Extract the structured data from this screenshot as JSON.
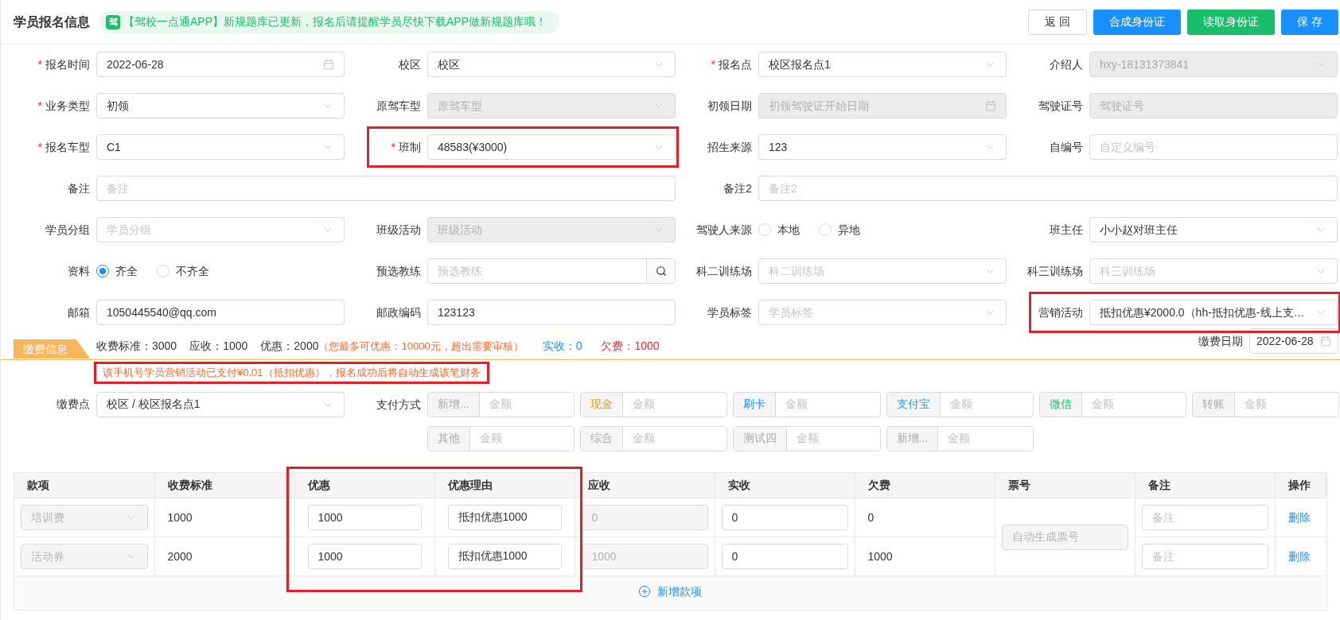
{
  "header": {
    "title": "学员报名信息",
    "notice": {
      "badge": "驾",
      "text": "【驾校一点通APP】新规题库已更新，报名后请提醒学员尽快下载APP做新规题库哦！"
    },
    "buttons": [
      {
        "label": "返 回",
        "kind": "default"
      },
      {
        "label": "合成身份证",
        "kind": "primary"
      },
      {
        "label": "读取身份证",
        "kind": "success"
      },
      {
        "label": "保 存",
        "kind": "primary"
      }
    ]
  },
  "form": {
    "fields": [
      {
        "required_mark": "*",
        "label": "报名时间",
        "kind": "date",
        "value": "2022-06-28",
        "disabled": false,
        "highlighted": false
      },
      {
        "label": "校区",
        "kind": "select",
        "value": "校区",
        "disabled": false,
        "highlighted": false
      },
      {
        "required_mark": "*",
        "label": "报名点",
        "kind": "select",
        "value": "校区报名点1",
        "disabled": false,
        "highlighted": false
      },
      {
        "label": "介绍人",
        "kind": "select",
        "value": "hxy-18131373841",
        "disabled": true,
        "highlighted": false
      },
      {
        "required_mark": "*",
        "label": "业务类型",
        "kind": "select",
        "value": "初领",
        "disabled": false,
        "highlighted": false
      },
      {
        "label": "原驾车型",
        "kind": "select",
        "placeholder": "原驾车型",
        "disabled": true,
        "highlighted": false
      },
      {
        "label": "初领日期",
        "kind": "date",
        "placeholder": "初领驾驶证开始日期",
        "disabled": true,
        "highlighted": false
      },
      {
        "label": "驾驶证号",
        "kind": "text",
        "placeholder": "驾驶证号",
        "disabled": true,
        "highlighted": false
      },
      {
        "required_mark": "*",
        "label": "报名车型",
        "kind": "select",
        "value": "C1",
        "disabled": false,
        "highlighted": false
      },
      {
        "required_mark": "*",
        "label": "班制",
        "kind": "select",
        "value": "48583(¥3000)",
        "disabled": false,
        "highlighted": true
      },
      {
        "label": "招生来源",
        "kind": "select",
        "value": "123",
        "disabled": false,
        "highlighted": false
      },
      {
        "label": "自编号",
        "kind": "text",
        "placeholder": "自定义编号",
        "disabled": false,
        "highlighted": false
      },
      {
        "label": "备注",
        "kind": "text",
        "placeholder": "备注",
        "wide": true,
        "disabled": false,
        "highlighted": false
      },
      {
        "label": "备注2",
        "kind": "text",
        "placeholder": "备注2",
        "wide": true,
        "disabled": false,
        "highlighted": false
      },
      {
        "label": "学员分组",
        "kind": "select",
        "placeholder": "学员分组",
        "disabled": false,
        "highlighted": false
      },
      {
        "label": "班级活动",
        "kind": "select",
        "placeholder": "班级活动",
        "disabled": true,
        "highlighted": false
      },
      {
        "label": "驾驶人来源",
        "kind": "radio",
        "options": [
          {
            "label": "本地",
            "selected": false
          },
          {
            "label": "异地",
            "selected": false
          }
        ],
        "highlighted": false
      },
      {
        "label": "班主任",
        "kind": "select",
        "value": "小小赵对班主任",
        "disabled": false,
        "highlighted": false
      },
      {
        "label": "资料",
        "kind": "radio",
        "options": [
          {
            "label": "齐全",
            "selected": true
          },
          {
            "label": "不齐全",
            "selected": false
          }
        ],
        "highlighted": false
      },
      {
        "label": "预选教练",
        "kind": "search",
        "placeholder": "预选教练",
        "disabled": false,
        "highlighted": false
      },
      {
        "label": "科二训练场",
        "kind": "select",
        "placeholder": "科二训练场",
        "disabled": false,
        "highlighted": false
      },
      {
        "label": "科三训练场",
        "kind": "select",
        "placeholder": "科三训练场",
        "disabled": false,
        "highlighted": false
      },
      {
        "label": "邮箱",
        "kind": "text",
        "value": "1050445540@qq.com",
        "disabled": false,
        "highlighted": false
      },
      {
        "label": "邮政编码",
        "kind": "text",
        "value": "123123",
        "disabled": false,
        "highlighted": false
      },
      {
        "label": "学员标签",
        "kind": "select",
        "placeholder": "学员标签",
        "disabled": false,
        "highlighted": false
      },
      {
        "label": "营销活动",
        "kind": "select",
        "value": "抵扣优惠¥2000.0（hh-抵扣优惠-线上支…",
        "disabled": false,
        "highlighted": true
      }
    ]
  },
  "fee": {
    "tab": "缴费信息",
    "summary": [
      {
        "label": "收费标准：",
        "value": "3000",
        "color": "#333333"
      },
      {
        "label": "应收：",
        "value": "1000",
        "color": "#333333"
      },
      {
        "label": "优惠：",
        "value": "2000",
        "color": "#333333"
      }
    ],
    "limit_note": "（您最多可优惠：10000元，超出需要审核）",
    "totals": [
      {
        "label": "实收：",
        "value": "0",
        "color": "#1890ff"
      },
      {
        "label": "欠费：",
        "value": "1000",
        "color": "#f5222d"
      }
    ],
    "date": {
      "label": "缴费日期",
      "value": "2022-06-28"
    },
    "notice": {
      "text": "该手机号学员营销活动已支付¥0.01（抵扣优惠），报名成功后将自动生成该笔财务",
      "highlighted": true
    }
  },
  "payment": {
    "point": {
      "label": "缴费点",
      "value": "校区 / 校区报名点1"
    },
    "methods_label": "支付方式",
    "methods": [
      {
        "label": "新增...",
        "color": "#aaaaaa",
        "placeholder": "金额"
      },
      {
        "label": "现金",
        "color": "#d4a017",
        "placeholder": "金额"
      },
      {
        "label": "刷卡",
        "color": "#1890ff",
        "placeholder": "金额"
      },
      {
        "label": "支付宝",
        "color": "#1ca3e6",
        "placeholder": "金额"
      },
      {
        "label": "微信",
        "color": "#19be6b",
        "placeholder": "金额"
      },
      {
        "label": "转账",
        "color": "#aaaaaa",
        "placeholder": "金额"
      },
      {
        "label": "其他",
        "color": "#aaaaaa",
        "placeholder": "金额"
      },
      {
        "label": "综合",
        "color": "#aaaaaa",
        "placeholder": "金额"
      },
      {
        "label": "测试四",
        "color": "#aaaaaa",
        "placeholder": "金额"
      },
      {
        "label": "新增...",
        "color": "#aaaaaa",
        "placeholder": "金额"
      }
    ]
  },
  "table": {
    "columns": [
      {
        "label": "款项",
        "highlighted": false
      },
      {
        "label": "收费标准",
        "highlighted": false
      },
      {
        "label": "优惠",
        "highlighted": true
      },
      {
        "label": "优惠理由",
        "highlighted": true
      },
      {
        "label": "应收",
        "highlighted": false
      },
      {
        "label": "实收",
        "highlighted": false
      },
      {
        "label": "欠费",
        "highlighted": false
      },
      {
        "label": "票号",
        "highlighted": false
      },
      {
        "label": "备注",
        "highlighted": false
      },
      {
        "label": "操作",
        "highlighted": false
      }
    ],
    "rows": [
      {
        "item": "培训费",
        "standard": "1000",
        "discount": "1000",
        "reason": "抵扣优惠1000",
        "receivable": "0",
        "received": "0",
        "owed": "0",
        "remark_placeholder": "备注",
        "action": "删除"
      },
      {
        "item": "活动券",
        "standard": "2000",
        "discount": "1000",
        "reason": "抵扣优惠1000",
        "receivable": "1000",
        "received": "0",
        "owed": "1000",
        "remark_placeholder": "备注",
        "action": "删除"
      }
    ],
    "ticket_placeholder": "自动生成票号",
    "add_label": "新增款项"
  }
}
